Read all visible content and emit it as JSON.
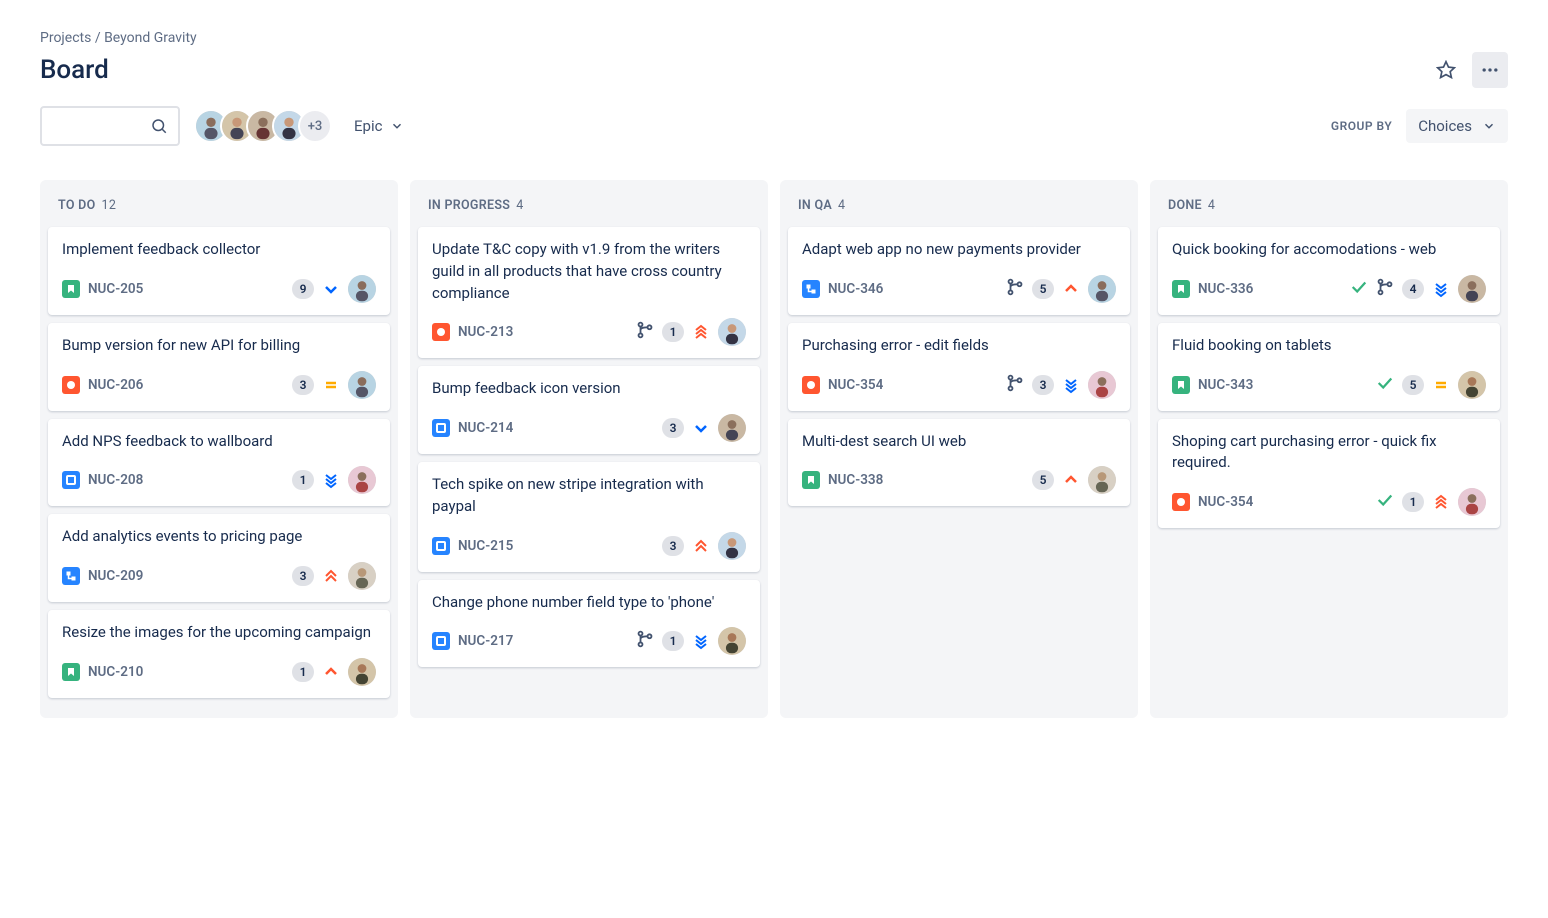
{
  "breadcrumb": {
    "root": "Projects",
    "project": "Beyond Gravity"
  },
  "title": "Board",
  "avatars_more": "+3",
  "filters": {
    "epic_label": "Epic"
  },
  "group_by": {
    "label": "GROUP BY",
    "value": "Choices"
  },
  "columns": [
    {
      "name": "TO DO",
      "count": "12",
      "cards": [
        {
          "title": "Implement feedback collector",
          "key": "NUC-205",
          "type": "story",
          "points": "9",
          "priority": "low",
          "assignee": 0
        },
        {
          "title": "Bump version for new API for billing",
          "key": "NUC-206",
          "type": "bug",
          "points": "3",
          "priority": "medium",
          "assignee": 0
        },
        {
          "title": "Add NPS feedback to wallboard",
          "key": "NUC-208",
          "type": "task",
          "points": "1",
          "priority": "lowest",
          "assignee": 1
        },
        {
          "title": "Add analytics events to pricing page",
          "key": "NUC-209",
          "type": "subtask",
          "points": "3",
          "priority": "high",
          "assignee": 2
        },
        {
          "title": "Resize the images for the upcoming campaign",
          "key": "NUC-210",
          "type": "story",
          "points": "1",
          "priority": "medium-up",
          "assignee": 3
        }
      ]
    },
    {
      "name": "IN PROGRESS",
      "count": "4",
      "cards": [
        {
          "title": "Update T&C copy with v1.9 from the writers guild in all products that have cross country compliance",
          "key": "NUC-213",
          "type": "bug",
          "branch": true,
          "points": "1",
          "priority": "highest",
          "assignee": 4
        },
        {
          "title": "Bump feedback icon version",
          "key": "NUC-214",
          "type": "task",
          "points": "3",
          "priority": "low",
          "assignee": 5
        },
        {
          "title": "Tech spike on new stripe integration with paypal",
          "key": "NUC-215",
          "type": "task",
          "points": "3",
          "priority": "high",
          "assignee": 4
        },
        {
          "title": "Change phone number field type to 'phone'",
          "key": "NUC-217",
          "type": "task",
          "branch": true,
          "points": "1",
          "priority": "lowest",
          "assignee": 3
        }
      ]
    },
    {
      "name": "IN QA",
      "count": "4",
      "cards": [
        {
          "title": "Adapt web app no new payments provider",
          "key": "NUC-346",
          "type": "subtask",
          "branch": true,
          "points": "5",
          "priority": "medium-up",
          "assignee": 0
        },
        {
          "title": "Purchasing error - edit fields",
          "key": "NUC-354",
          "type": "bug",
          "branch": true,
          "points": "3",
          "priority": "lowest",
          "assignee": 1
        },
        {
          "title": "Multi-dest search UI web",
          "key": "NUC-338",
          "type": "story",
          "points": "5",
          "priority": "medium-up",
          "assignee": 2
        }
      ]
    },
    {
      "name": "DONE",
      "count": "4",
      "cards": [
        {
          "title": "Quick booking for accomodations - web",
          "key": "NUC-336",
          "type": "story",
          "done": true,
          "branch": true,
          "points": "4",
          "priority": "lowest",
          "assignee": 5
        },
        {
          "title": "Fluid booking on tablets",
          "key": "NUC-343",
          "type": "story",
          "done": true,
          "points": "5",
          "priority": "medium",
          "assignee": 3
        },
        {
          "title": "Shoping cart purchasing error - quick fix required.",
          "key": "NUC-354",
          "type": "bug",
          "done": true,
          "points": "1",
          "priority": "highest",
          "assignee": 1
        }
      ]
    }
  ]
}
